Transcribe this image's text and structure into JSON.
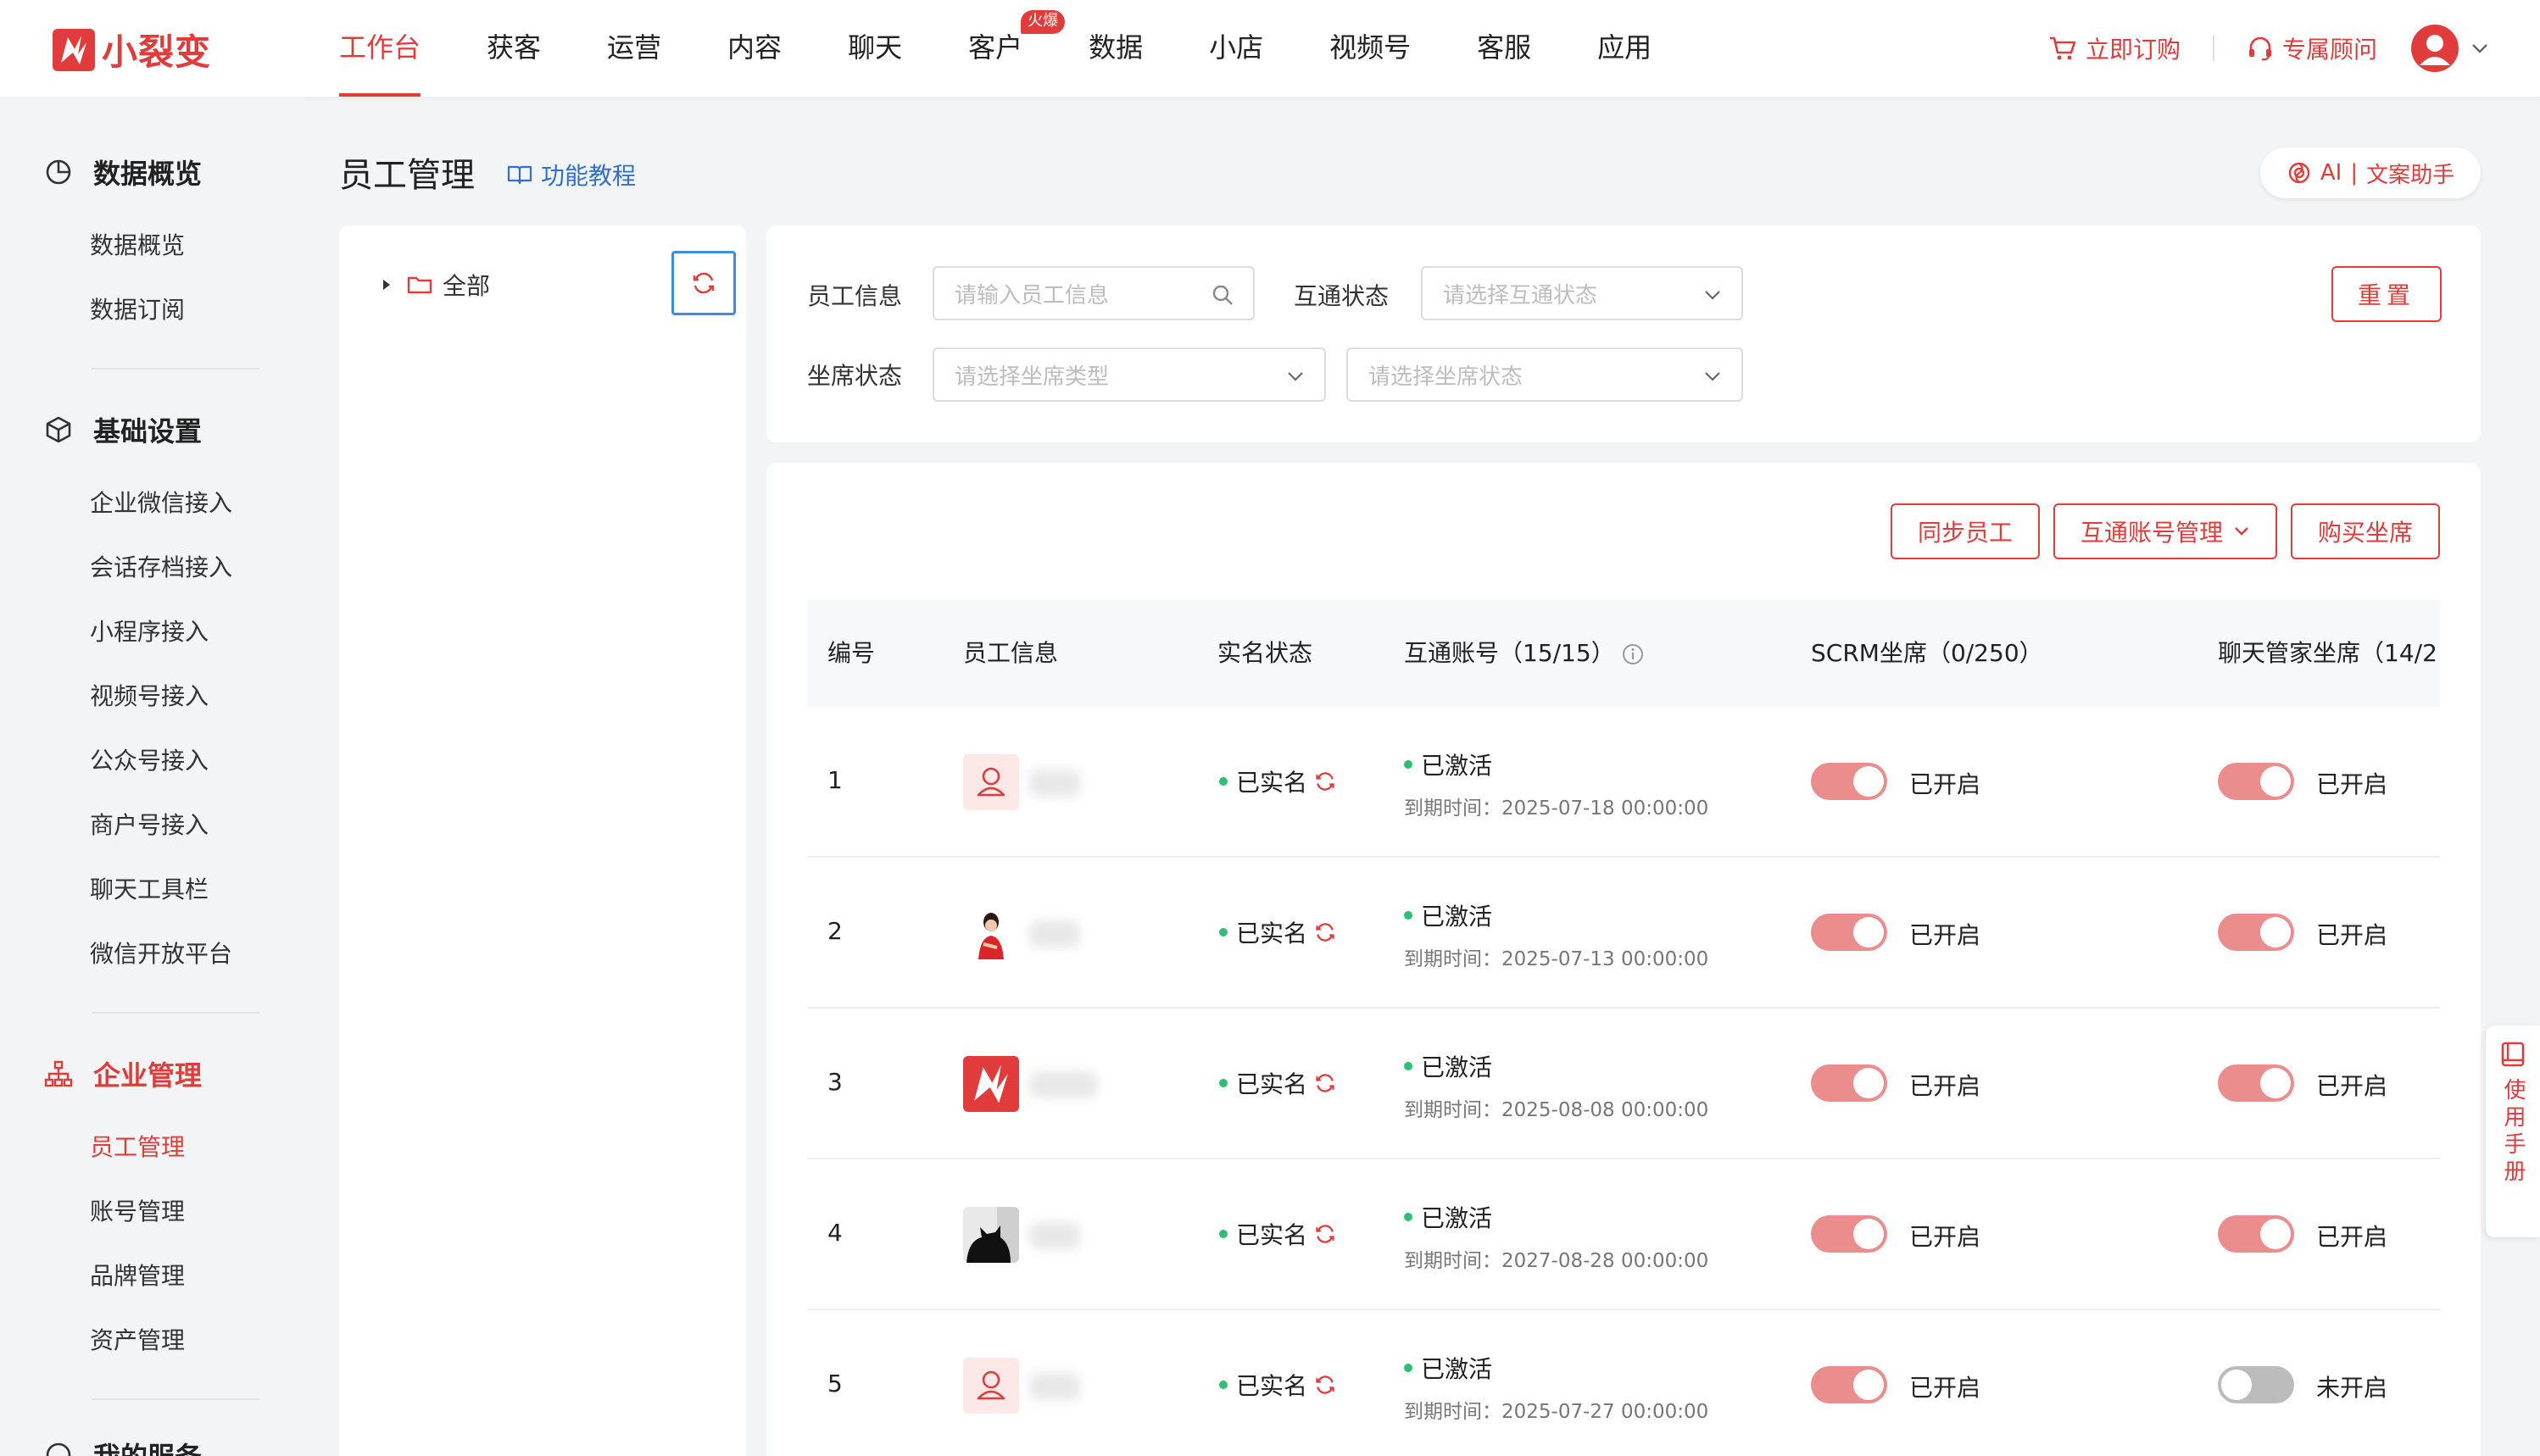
{
  "brand": {
    "name": "小裂变"
  },
  "nav": {
    "items": [
      {
        "label": "工作台"
      },
      {
        "label": "获客"
      },
      {
        "label": "运营"
      },
      {
        "label": "内容"
      },
      {
        "label": "聊天"
      },
      {
        "label": "客户",
        "badge": "火爆"
      },
      {
        "label": "数据"
      },
      {
        "label": "小店"
      },
      {
        "label": "视频号"
      },
      {
        "label": "客服"
      },
      {
        "label": "应用"
      }
    ],
    "subscribe": "立即订购",
    "advisor": "专属顾问"
  },
  "sidebar": {
    "groups": [
      {
        "title": "数据概览",
        "items": [
          "数据概览",
          "数据订阅"
        ]
      },
      {
        "title": "基础设置",
        "items": [
          "企业微信接入",
          "会话存档接入",
          "小程序接入",
          "视频号接入",
          "公众号接入",
          "商户号接入",
          "聊天工具栏",
          "微信开放平台"
        ]
      },
      {
        "title": "企业管理",
        "items": [
          "员工管理",
          "账号管理",
          "品牌管理",
          "资产管理"
        ]
      },
      {
        "title": "我的服务",
        "items": []
      }
    ]
  },
  "page": {
    "title": "员工管理",
    "tutorial": "功能教程",
    "ai_label": "AI",
    "ai_assistant": "文案助手"
  },
  "tree": {
    "root": "全部"
  },
  "filters": {
    "employee_label": "员工信息",
    "employee_placeholder": "请输入员工信息",
    "link_status_label": "互通状态",
    "link_status_placeholder": "请选择互通状态",
    "seat_label": "坐席状态",
    "seat_type_placeholder": "请选择坐席类型",
    "seat_status_placeholder": "请选择坐席状态",
    "reset": "重置"
  },
  "actions": {
    "sync": "同步员工",
    "account_manage": "互通账号管理",
    "buy_seat": "购买坐席"
  },
  "table": {
    "headers": {
      "no": "编号",
      "employee": "员工信息",
      "verify": "实名状态",
      "account": "互通账号（15/15）",
      "scrm": "SCRM坐席（0/250）",
      "chat": "聊天管家坐席（14/2"
    },
    "rows": [
      {
        "no": "1",
        "verify": "已实名",
        "status": "已激活",
        "expire": "到期时间：2025-07-18 00:00:00",
        "scrm": "已开启",
        "chat": "已开启",
        "chat_on": true,
        "avatar": "person-icon"
      },
      {
        "no": "2",
        "verify": "已实名",
        "status": "已激活",
        "expire": "到期时间：2025-07-13 00:00:00",
        "scrm": "已开启",
        "chat": "已开启",
        "chat_on": true,
        "avatar": "photo"
      },
      {
        "no": "3",
        "verify": "已实名",
        "status": "已激活",
        "expire": "到期时间：2025-08-08 00:00:00",
        "scrm": "已开启",
        "chat": "已开启",
        "chat_on": true,
        "avatar": "brand-logo"
      },
      {
        "no": "4",
        "verify": "已实名",
        "status": "已激活",
        "expire": "到期时间：2027-08-28 00:00:00",
        "scrm": "已开启",
        "chat": "已开启",
        "chat_on": true,
        "avatar": "cat-photo"
      },
      {
        "no": "5",
        "verify": "已实名",
        "status": "已激活",
        "expire": "到期时间：2025-07-27 00:00:00",
        "scrm": "已开启",
        "chat": "未开启",
        "chat_on": false,
        "avatar": "person-icon"
      }
    ]
  },
  "manual": {
    "label": "使用手册"
  },
  "colors": {
    "accent": "#e23b3b",
    "link": "#2f6fd1",
    "success": "#2fbf71"
  }
}
